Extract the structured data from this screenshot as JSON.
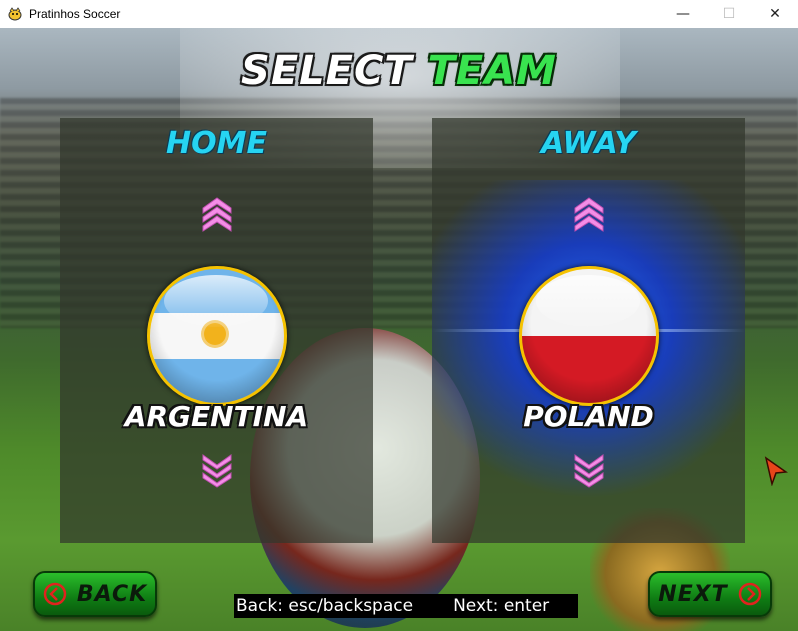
{
  "window": {
    "title": "Pratinhos Soccer",
    "controls": {
      "minimize": "—",
      "maximize": "☐",
      "close": "✕"
    }
  },
  "heading": {
    "word1": "SELECT",
    "word2": "TEAM"
  },
  "home": {
    "label": "HOME",
    "team": "ARGENTINA"
  },
  "away": {
    "label": "AWAY",
    "team": "POLAND"
  },
  "buttons": {
    "back": "BACK",
    "next": "NEXT"
  },
  "hints": {
    "back": "Back: esc/backspace",
    "next": "Next: enter"
  },
  "colors": {
    "accent_cyan": "#26d4f2",
    "title_green": "#39e34f",
    "button_green": "#1a9a1e",
    "arrow_pink": "#f48de6",
    "flag_ring": "#f5c200"
  }
}
